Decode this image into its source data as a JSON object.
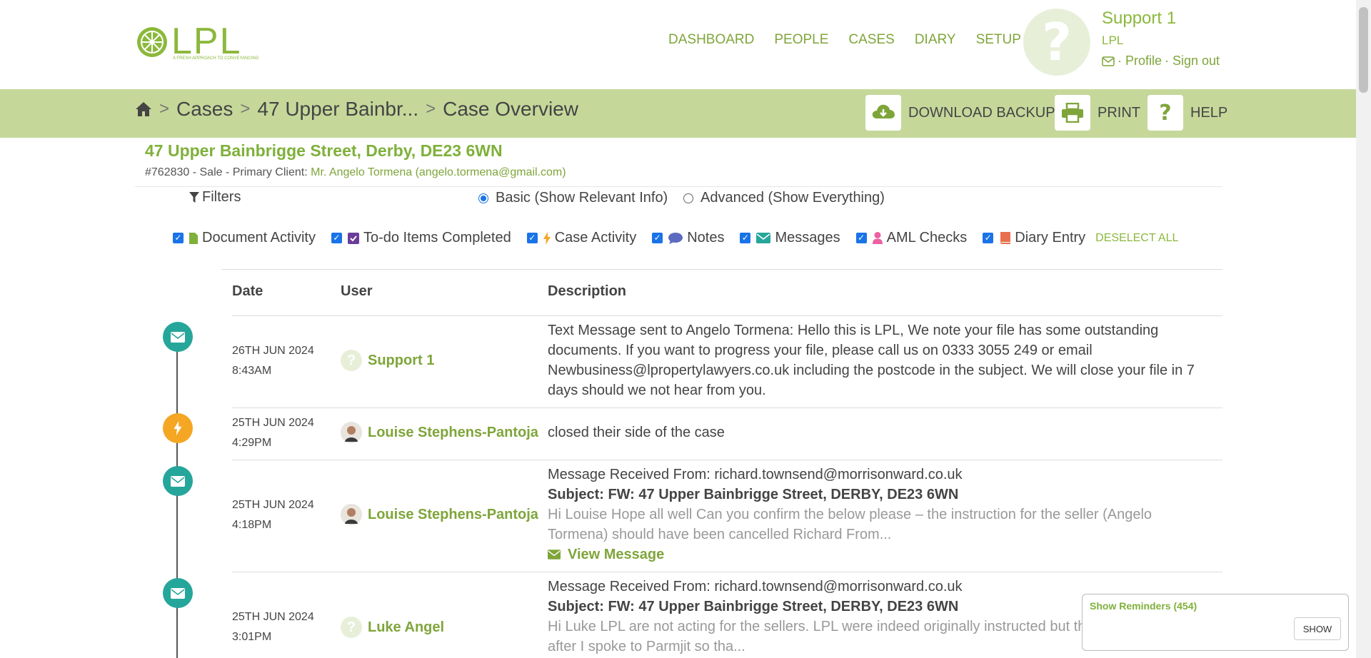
{
  "header": {
    "logo_text": "LPL",
    "logo_tagline": "A FRESH APPROACH TO CONVEYANCING",
    "nav": [
      "DASHBOARD",
      "PEOPLE",
      "CASES",
      "DIARY",
      "SETUP"
    ],
    "user_name": "Support 1",
    "user_org": "LPL",
    "links": [
      "· Profile",
      "· Sign out"
    ]
  },
  "breadcrumb": [
    "Cases",
    "47 Upper Bainbr...",
    "Case Overview"
  ],
  "toolbar": {
    "download": "DOWNLOAD BACKUP",
    "print": "PRINT",
    "help": "HELP"
  },
  "case": {
    "title": "47 Upper Bainbrigge Street, Derby, DE23 6WN",
    "meta": "#762830 - Sale - Primary Client: ",
    "client": "Mr. Angelo Tormena (angelo.tormena@gmail.com)"
  },
  "filters": {
    "label": "Filters",
    "basic": "Basic (Show Relevant Info)",
    "advanced": "Advanced (Show Everything)",
    "checks": [
      "Document Activity",
      "To-do Items Completed",
      "Case Activity",
      "Notes",
      "Messages",
      "AML Checks",
      "Diary Entry"
    ],
    "deselect_all": "DESELECT ALL"
  },
  "table": {
    "headers": [
      "Date",
      "User",
      "Description"
    ],
    "rows": [
      {
        "date": "26TH JUN 2024",
        "time": "8:43AM",
        "user": "Support 1",
        "desc": "Text Message sent to Angelo Tormena: Hello this is LPL, We note your file has some outstanding documents. If you want to progress your file, please call us on 0333 3055 249 or email Newbusiness@lpropertylawyers.co.uk including the postcode in the subject. We will close your file in 7 days should we not hear from you."
      },
      {
        "date": "25TH JUN 2024",
        "time": "4:29PM",
        "user": "Louise Stephens-Pantoja",
        "desc": "closed their side of the case"
      },
      {
        "date": "25TH JUN 2024",
        "time": "4:18PM",
        "user": "Louise Stephens-Pantoja",
        "from": "Message Received From: richard.townsend@morrisonward.co.uk",
        "subject": "Subject: FW: 47 Upper Bainbrigge Street, DERBY, DE23 6WN",
        "preview": "Hi Louise Hope all well Can you confirm the below please – the instruction for the seller (Angelo Tormena) should have been cancelled Richard From...",
        "view": "View Message"
      },
      {
        "date": "25TH JUN 2024",
        "time": "3:01PM",
        "user": "Luke Angel",
        "from": "Message Received From: richard.townsend@morrisonward.co.uk",
        "subject": "Subject: FW: 47 Upper Bainbrigge Street, DERBY, DE23 6WN",
        "preview": "Hi Luke LPL are not acting for the sellers. LPL were indeed originally instructed but this w",
        "preview2": "after I spoke to Parmjit so tha..."
      }
    ]
  },
  "reminders": {
    "title": "Show Reminders (454)",
    "show": "SHOW"
  },
  "colors": {
    "brand_green": "#8cb83c",
    "bar_green": "#c5d89a",
    "teal": "#26a69a",
    "orange": "#f5a623"
  }
}
